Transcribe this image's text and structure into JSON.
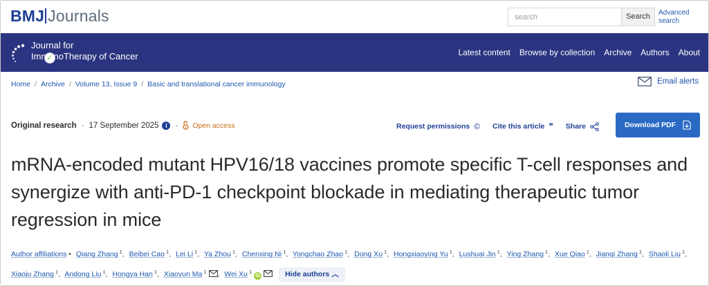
{
  "site": {
    "logo_bmj": "BMJ",
    "logo_journals": "Journals",
    "search_placeholder": "search",
    "search_button": "Search",
    "advanced_search": "Advanced search"
  },
  "journal": {
    "title_line1": "Journal for",
    "title_line2": "ImmunoTherapy of Cancer",
    "nav": [
      "Latest content",
      "Browse by collection",
      "Archive",
      "Authors",
      "About"
    ]
  },
  "breadcrumb": [
    "Home",
    "Archive",
    "Volume 13, Issue 9",
    "Basic and translational cancer immunology"
  ],
  "email_alerts": "Email alerts",
  "article": {
    "type": "Original research",
    "date": "17 September 2025",
    "open_access": "Open access",
    "actions": {
      "request_permissions": "Request permissions",
      "cite": "Cite this article",
      "share": "Share"
    },
    "download": "Download PDF",
    "title": "mRNA-encoded mutant HPV16/18 vaccines promote specific T-cell responses and synergize with anti-PD-1 checkpoint blockade in mediating therapeutic tumor regression in mice",
    "author_affiliations": "Author affiliations",
    "authors": [
      {
        "name": "Qiang Zhang",
        "sup": "1"
      },
      {
        "name": "Beibei Cao",
        "sup": "1"
      },
      {
        "name": "Lei Li",
        "sup": "1"
      },
      {
        "name": "Ya Zhou",
        "sup": "1"
      },
      {
        "name": "Chenxing Ni",
        "sup": "1"
      },
      {
        "name": "Yongchao Zhao",
        "sup": "1"
      },
      {
        "name": "Dong Xu",
        "sup": "1"
      },
      {
        "name": "Hongxiaoying Yu",
        "sup": "1"
      },
      {
        "name": "Lushuai Jin",
        "sup": "1"
      },
      {
        "name": "Ying Zhang",
        "sup": "1"
      },
      {
        "name": "Xue Qiao",
        "sup": "1"
      },
      {
        "name": "Jianqi Zhang",
        "sup": "1"
      },
      {
        "name": "Shaoli Liu",
        "sup": "1"
      },
      {
        "name": "Xiaoju Zhang",
        "sup": "1"
      },
      {
        "name": "Andong Liu",
        "sup": "1"
      },
      {
        "name": "Hongya Han",
        "sup": "1"
      },
      {
        "name": "Xiaoyun Ma",
        "sup": "1"
      },
      {
        "name": "Wei Xu",
        "sup": "1"
      }
    ],
    "hide_authors": "Hide authors"
  },
  "colors": {
    "banner": "#2b3480",
    "link": "#1d57b0",
    "download_button": "#2a6ac4",
    "open_access": "#c96b18"
  }
}
